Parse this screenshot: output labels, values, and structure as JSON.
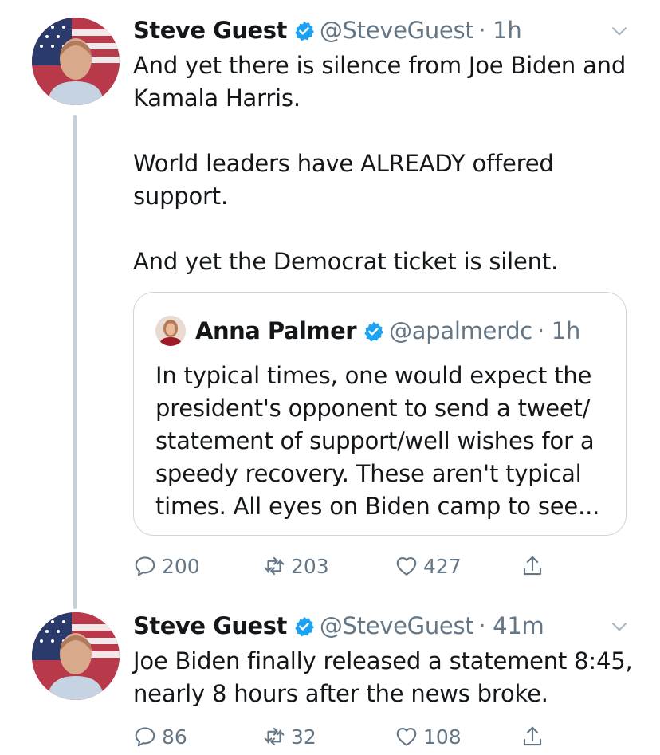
{
  "tweet1": {
    "author_name": "Steve Guest",
    "handle": "@SteveGuest",
    "time": "· 1h",
    "paragraphs": [
      "And yet there is silence from Joe Biden and Kamala Harris.",
      "World leaders have ALREADY offered support.",
      "And yet the Democrat ticket is silent."
    ],
    "quote": {
      "author_name": "Anna Palmer",
      "handle": "@apalmerdc",
      "time": "· 1h",
      "text": "In typical times, one would expect the president's opponent to send a tweet/ statement of support/well wishes for a speedy recovery. These aren't typical times. All eyes on Biden camp to see..."
    },
    "actions": {
      "replies": "200",
      "retweets": "203",
      "likes": "427"
    }
  },
  "tweet2": {
    "author_name": "Steve Guest",
    "handle": "@SteveGuest",
    "time": "· 41m",
    "text": "Joe Biden finally released a statement 8:45, nearly 8 hours after the news broke.",
    "actions": {
      "replies": "86",
      "retweets": "32",
      "likes": "108"
    }
  },
  "colors": {
    "verified": "#1da1f2",
    "secondary_text": "#657786",
    "border": "#ccd6dd"
  }
}
